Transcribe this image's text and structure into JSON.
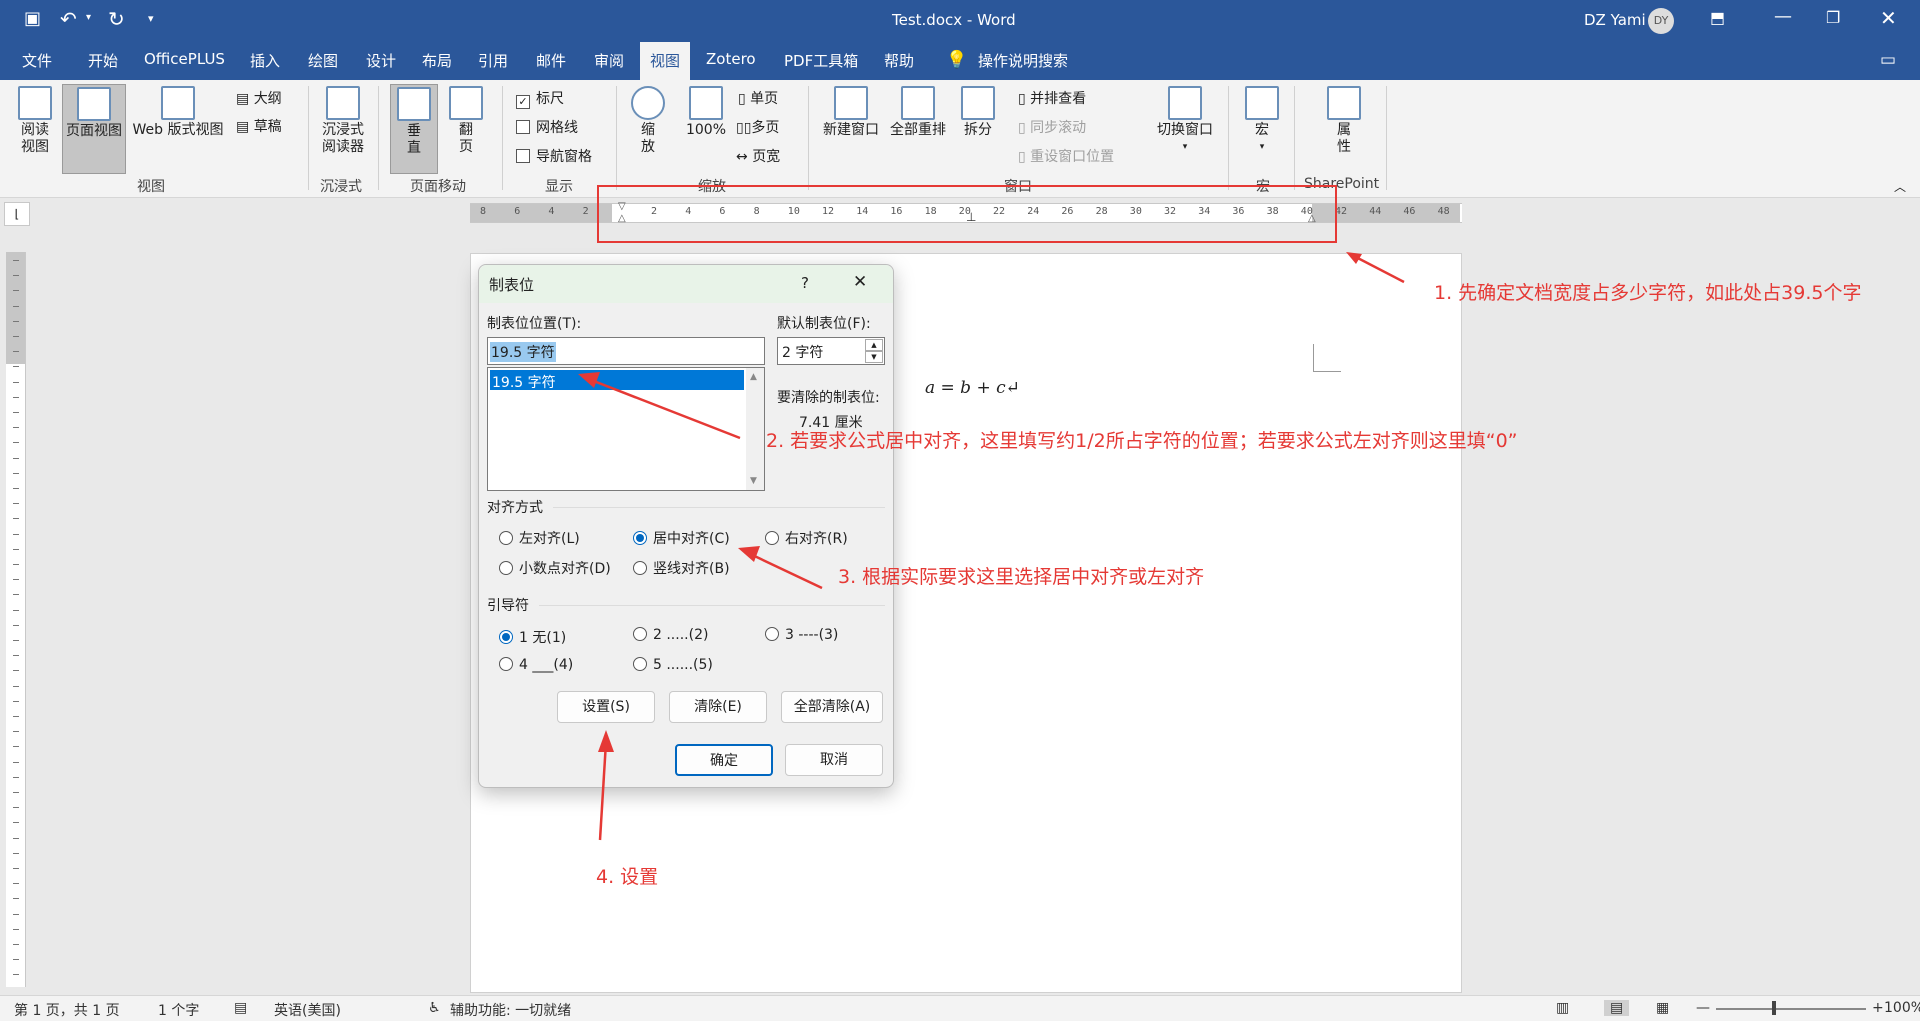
{
  "titlebar": {
    "doc_title": "Test.docx  -  Word",
    "user_name": "DZ Yami",
    "user_initials": "DY"
  },
  "tabs": [
    "文件",
    "开始",
    "OfficePLUS",
    "插入",
    "绘图",
    "设计",
    "布局",
    "引用",
    "邮件",
    "审阅",
    "视图",
    "Zotero",
    "PDF工具箱",
    "帮助"
  ],
  "active_tab": "视图",
  "tell_me": "操作说明搜索",
  "ribbon": {
    "view": {
      "read": "阅读\n视图",
      "page": "页面视图",
      "web": "Web 版式视图",
      "outline": "大纲",
      "draft": "草稿",
      "label": "视图"
    },
    "immersive": {
      "reader": "沉浸式\n阅读器",
      "label": "沉浸式"
    },
    "page_move": {
      "vertical": "垂\n直",
      "flip": "翻\n页",
      "label": "页面移动"
    },
    "show": {
      "ruler": "标尺",
      "gridlines": "网格线",
      "nav": "导航窗格",
      "label": "显示"
    },
    "zoom": {
      "zoom": "缩\n放",
      "hundred": "100%",
      "one_page": "单页",
      "multi_page": "多页",
      "page_width": "页宽",
      "label": "缩放"
    },
    "window": {
      "new": "新建窗口",
      "arrange": "全部重排",
      "split": "拆分",
      "side": "并排查看",
      "sync": "同步滚动",
      "reset": "重设窗口位置",
      "switch": "切换窗口",
      "label": "窗口"
    },
    "macro": {
      "macro": "宏",
      "label": "宏"
    },
    "sharepoint": {
      "props": "属\n性",
      "label": "SharePoint"
    }
  },
  "ruler_numbers": [
    "8",
    "6",
    "4",
    "2",
    "",
    "2",
    "4",
    "6",
    "8",
    "10",
    "12",
    "14",
    "16",
    "18",
    "20",
    "22",
    "24",
    "26",
    "28",
    "30",
    "32",
    "34",
    "36",
    "38",
    "40",
    "42",
    "44",
    "46",
    "48"
  ],
  "document": {
    "formula": "a = b + c↵"
  },
  "dialog": {
    "title": "制表位",
    "help": "?",
    "close": "✕",
    "tab_pos_label": "制表位位置(T):",
    "tab_pos_value": "19.5 字符",
    "list_items": [
      "19.5 字符"
    ],
    "default_label": "默认制表位(F):",
    "default_value": "2 字符",
    "clear_label": "要清除的制表位:",
    "clear_value": "7.41 厘米",
    "align_label": "对齐方式",
    "align": {
      "left": "左对齐(L)",
      "center": "居中对齐(C)",
      "right": "右对齐(R)",
      "decimal": "小数点对齐(D)",
      "bar": "竖线对齐(B)"
    },
    "leader_label": "引导符",
    "leader": {
      "l1": "1 无(1)",
      "l2": "2 .....(2)",
      "l3": "3 ----(3)",
      "l4": "4 ___(4)",
      "l5": "5 ......(5)"
    },
    "btn_set": "设置(S)",
    "btn_clear": "清除(E)",
    "btn_clear_all": "全部清除(A)",
    "btn_ok": "确定",
    "btn_cancel": "取消"
  },
  "annotations": {
    "a1": "1. 先确定文档宽度占多少字符，如此处占39.5个字",
    "a2": "2. 若要求公式居中对齐，这里填写约1/2所占字符的位置；若要求公式左对齐则这里填“0”",
    "a3": "3. 根据实际要求这里选择居中对齐或左对齐",
    "a4": "4. 设置"
  },
  "status": {
    "page": "第 1 页，共 1 页",
    "words": "1 个字",
    "lang": "英语(美国)",
    "access": "辅助功能: 一切就绪",
    "zoom": "100%"
  },
  "colors": {
    "word_blue": "#2b579a",
    "annotation_red": "#e53935",
    "accent": "#0067c0"
  }
}
